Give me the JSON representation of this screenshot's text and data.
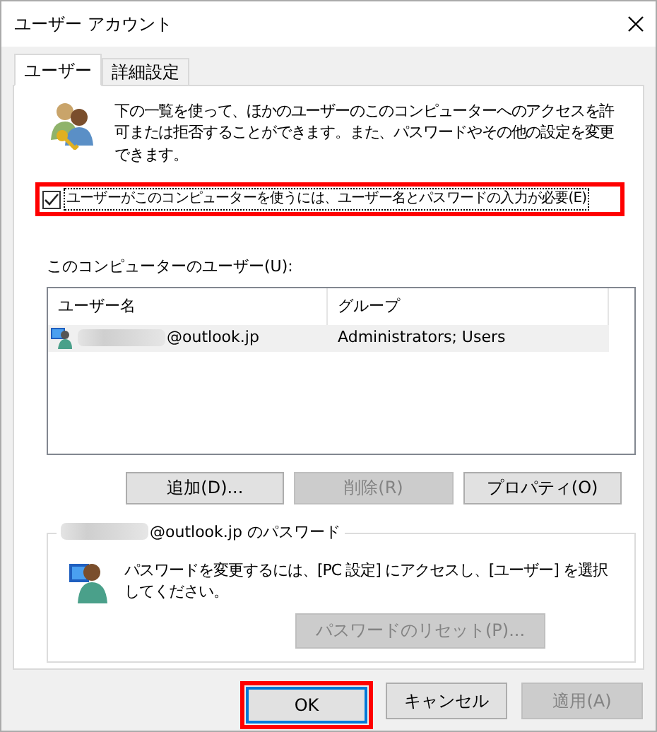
{
  "window": {
    "title": "ユーザー アカウント"
  },
  "tabs": [
    {
      "label": "ユーザー",
      "selected": true
    },
    {
      "label": "詳細設定",
      "selected": false
    }
  ],
  "intro": {
    "text": "下の一覧を使って、ほかのユーザーのこのコンピューターへのアクセスを許可または拒否することができます。また、パスワードやその他の設定を変更できます。"
  },
  "require_password": {
    "label": "ユーザーがこのコンピューターを使うには、ユーザー名とパスワードの入力が必要(E)",
    "checked": true,
    "highlighted": true
  },
  "users": {
    "label": "このコンピューターのユーザー(U):",
    "columns": [
      "ユーザー名",
      "グループ"
    ],
    "rows": [
      {
        "name": "@outlook.jp",
        "name_blurred": true,
        "group": "Administrators; Users",
        "selected": true
      }
    ]
  },
  "user_buttons": [
    {
      "label": "追加(D)...",
      "disabled": false
    },
    {
      "label": "削除(R)",
      "disabled": true
    },
    {
      "label": "プロパティ(O)",
      "disabled": false
    }
  ],
  "password_group": {
    "title": "@outlook.jp のパスワード",
    "title_blurred": true,
    "text": "パスワードを変更するには、[PC 設定] にアクセスし、[ユーザー] を選択してください。",
    "reset_button": {
      "label": "パスワードのリセット(P)...",
      "disabled": true
    }
  },
  "dialog_buttons": [
    {
      "label": "OK",
      "default": true,
      "highlighted": true,
      "disabled": false
    },
    {
      "label": "キャンセル",
      "default": false,
      "highlighted": false,
      "disabled": false
    },
    {
      "label": "適用(A)",
      "default": false,
      "highlighted": false,
      "disabled": true
    }
  ]
}
